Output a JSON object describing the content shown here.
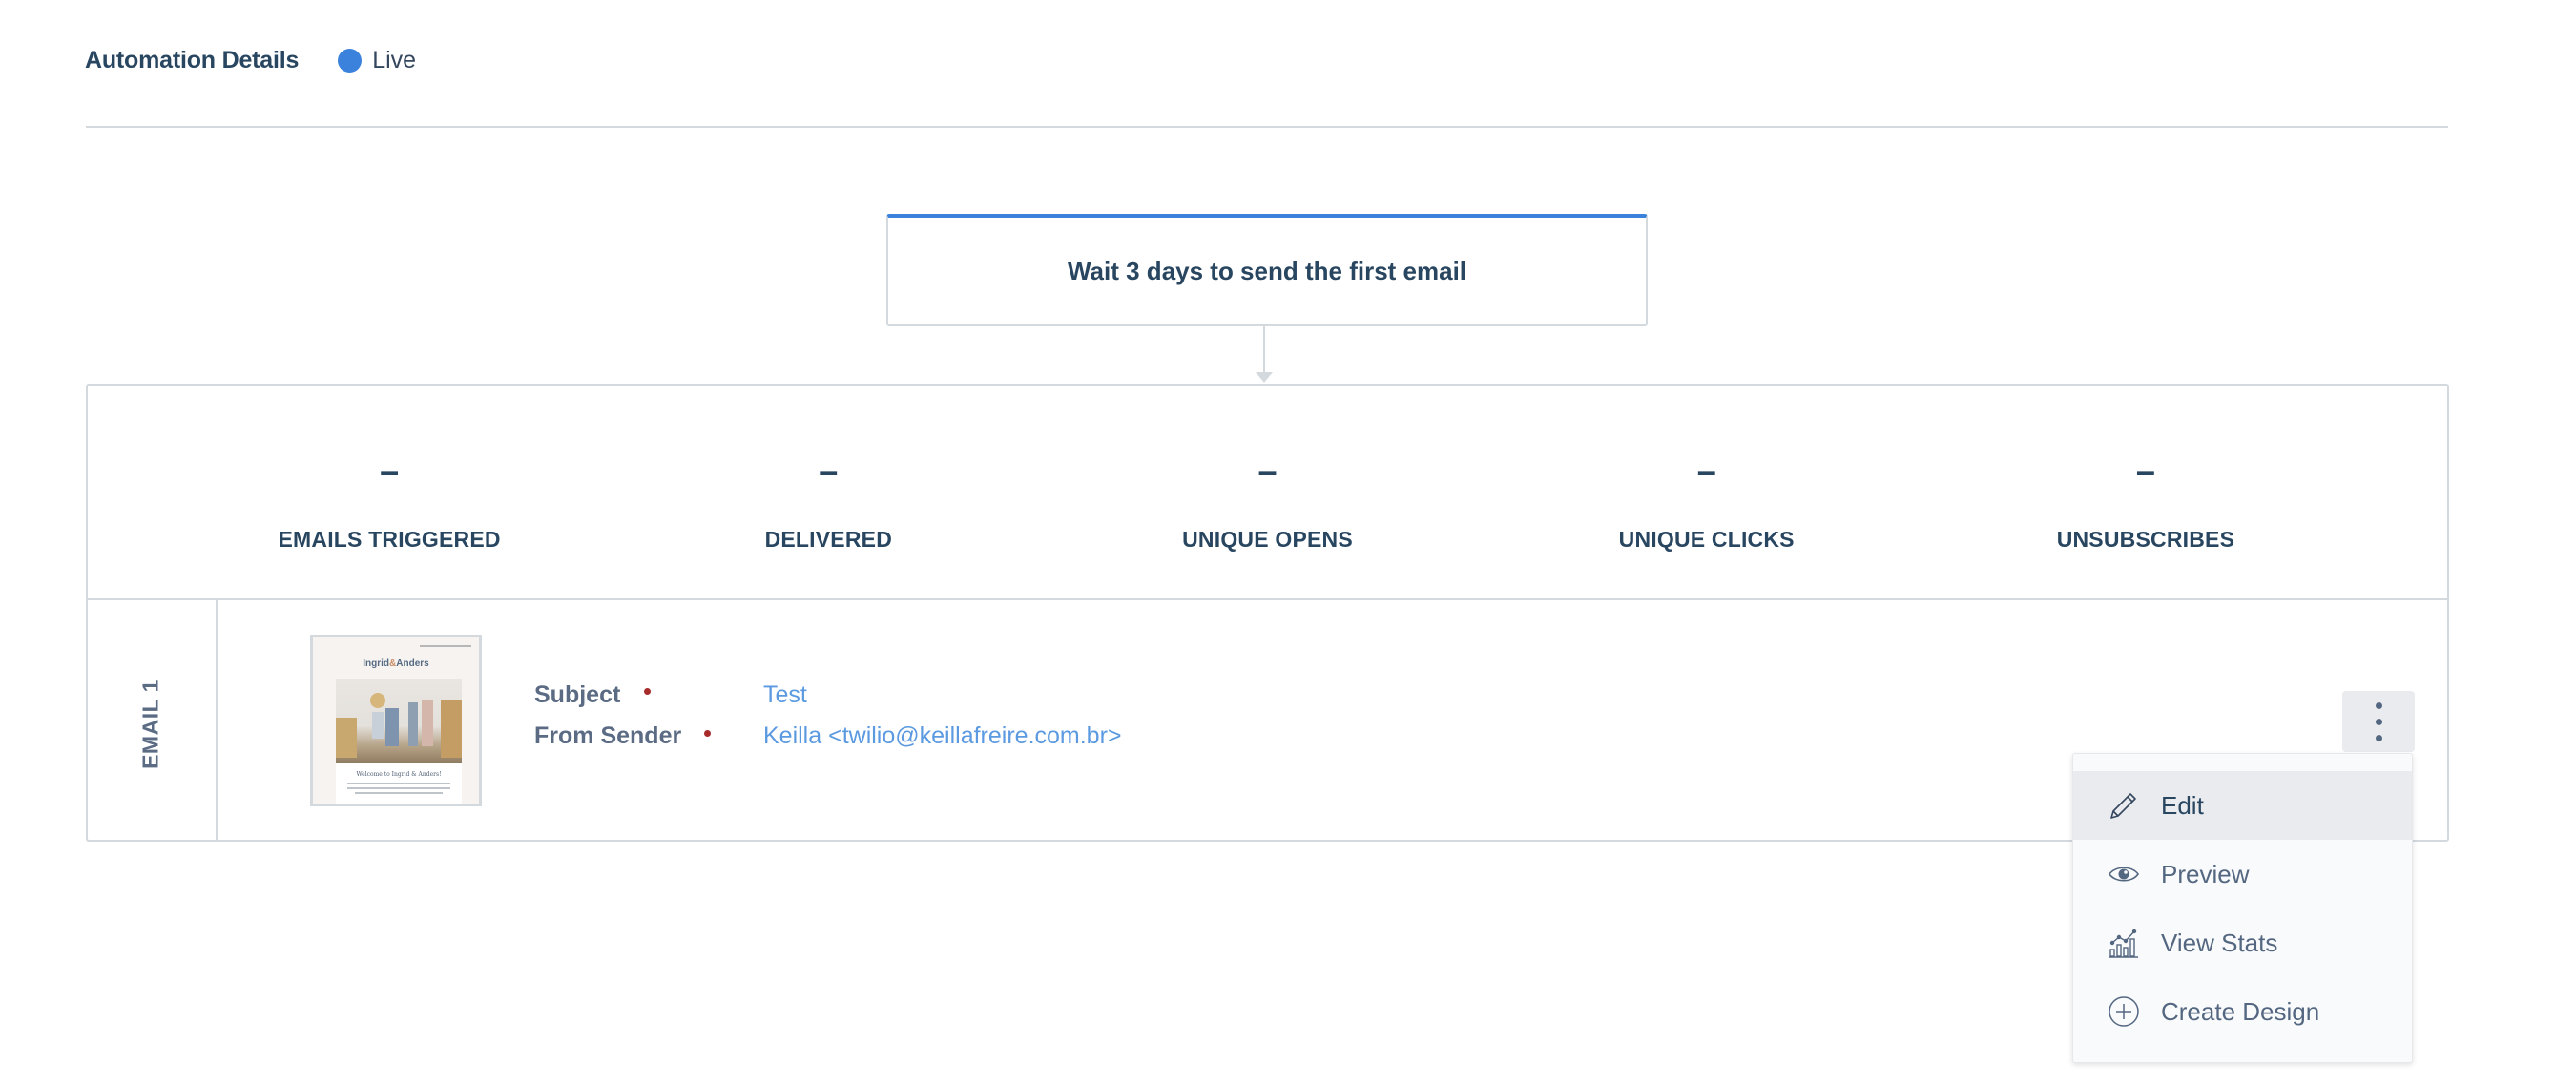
{
  "header": {
    "title": "Automation Details",
    "status": {
      "label": "Live",
      "color": "#3a82db"
    }
  },
  "wait_step": {
    "text": "Wait 3 days to send the first email"
  },
  "stats": [
    {
      "value": "–",
      "label": "EMAILS TRIGGERED"
    },
    {
      "value": "–",
      "label": "DELIVERED"
    },
    {
      "value": "–",
      "label": "UNIQUE OPENS"
    },
    {
      "value": "–",
      "label": "UNIQUE CLICKS"
    },
    {
      "value": "–",
      "label": "UNSUBSCRIBES"
    }
  ],
  "email": {
    "label": "EMAIL 1",
    "thumbnail": {
      "logo_left": "Ingrid",
      "logo_amp": "&",
      "logo_right": "Anders",
      "heading": "Welcome to Ingrid & Anders!"
    },
    "fields": [
      {
        "label": "Subject",
        "value": "Test",
        "required": true
      },
      {
        "label": "From Sender",
        "value": "Keilla <twilio@keillafreire.com.br>",
        "required": true
      }
    ],
    "actions_icon": "more-vertical-icon"
  },
  "menu": {
    "items": [
      {
        "label": "Edit",
        "icon": "pencil-icon",
        "active": true
      },
      {
        "label": "Preview",
        "icon": "eye-icon",
        "active": false
      },
      {
        "label": "View Stats",
        "icon": "stats-chart-icon",
        "active": false
      },
      {
        "label": "Create Design",
        "icon": "plus-circle-icon",
        "active": false
      }
    ]
  }
}
